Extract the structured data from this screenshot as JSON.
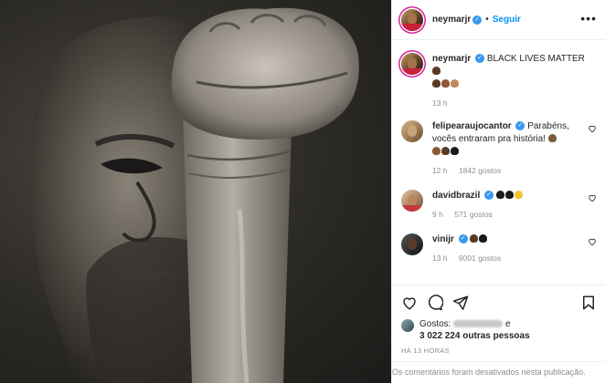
{
  "header": {
    "username": "neymarjr",
    "follow_label": "Seguir",
    "separator": "•",
    "more_label": "•••"
  },
  "caption": {
    "username": "neymarjr",
    "text": "BLACK LIVES MATTER",
    "time": "13 h"
  },
  "comments": [
    {
      "username": "felipearaujocantor",
      "text": "Parabéns, vocês entraram pra história!",
      "time": "12 h",
      "likes": "1842 gostos"
    },
    {
      "username": "davidbrazil",
      "text": "",
      "time": "9 h",
      "likes": "571 gostos"
    },
    {
      "username": "vinijr",
      "text": "",
      "time": "13 h",
      "likes": "9001 gostos"
    }
  ],
  "likes": {
    "prefix": "Gostos:",
    "connector": "e",
    "count_text": "3 022 224 outras pessoas"
  },
  "timestamp": "HÁ 13 HORAS",
  "comments_disabled": "Os comentários foram desativados nesta publicação.",
  "icons": [
    "heart-icon",
    "comment-icon",
    "share-icon",
    "bookmark-icon",
    "verified-icon",
    "more-icon"
  ],
  "colors": {
    "link": "#0095f6",
    "verified": "#3897f0",
    "muted": "#8e8e8e"
  }
}
